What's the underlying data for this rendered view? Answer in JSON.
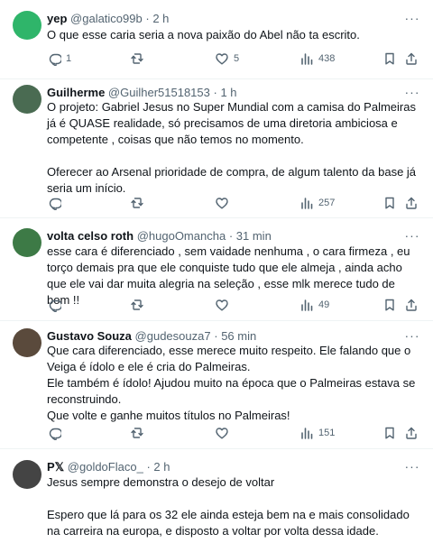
{
  "more_glyph": "···",
  "tweets": [
    {
      "name": "yep",
      "handle": "@galatico99b",
      "dot": "·",
      "time": "2 h",
      "paragraphs": [
        "O que esse caria seria a nova paixão do Abel não ta escrito."
      ],
      "replies": "1",
      "retweets": "",
      "likes": "5",
      "views": "438",
      "avatar_color": "#2fb56a"
    },
    {
      "name": "Guilherme",
      "handle": "@Guilher51518153",
      "dot": "·",
      "time": "1 h",
      "paragraphs": [
        "O projeto: Gabriel Jesus no Super Mundial com a camisa do Palmeiras já é QUASE  realidade, só precisamos de uma diretoria ambiciosa e competente , coisas que não temos no momento.",
        "",
        "Oferecer ao Arsenal prioridade de compra, de algum talento da base já seria um início."
      ],
      "replies": "",
      "retweets": "",
      "likes": "",
      "views": "257",
      "avatar_color": "#4a6b52"
    },
    {
      "name": "volta celso roth",
      "handle": "@hugoOmancha",
      "dot": "·",
      "time": "31 min",
      "paragraphs": [
        "esse cara é diferenciado , sem vaidade nenhuma , o cara firmeza , eu torço demais pra que ele conquiste tudo que ele almeja , ainda acho que ele vai dar muita alegria na seleção , esse mlk merece tudo de bom !!"
      ],
      "replies": "",
      "retweets": "",
      "likes": "",
      "views": "49",
      "avatar_color": "#3d7a46"
    },
    {
      "name": "Gustavo Souza",
      "handle": "@gudesouza7",
      "dot": "·",
      "time": "56 min",
      "paragraphs": [
        "Que cara diferenciado, esse merece muito respeito. Ele falando que o Veiga é ídolo e ele é cria do Palmeiras.",
        "Ele também é ídolo! Ajudou muito na época que o Palmeiras estava se reconstruindo.",
        "Que volte e ganhe muitos títulos no Palmeiras!"
      ],
      "replies": "",
      "retweets": "",
      "likes": "",
      "views": "151",
      "avatar_color": "#5a4a3c"
    },
    {
      "name": "P𝕏",
      "handle": "@goldoFlaco_",
      "dot": "·",
      "time": "2 h",
      "paragraphs": [
        "Jesus sempre demonstra o desejo de voltar",
        "",
        "Espero que lá para os 32 ele ainda esteja bem na e  mais consolidado na carreira na europa, e disposto a voltar por volta dessa idade."
      ],
      "replies": "",
      "retweets": "",
      "likes": "",
      "views": "",
      "avatar_color": "#444444"
    }
  ]
}
